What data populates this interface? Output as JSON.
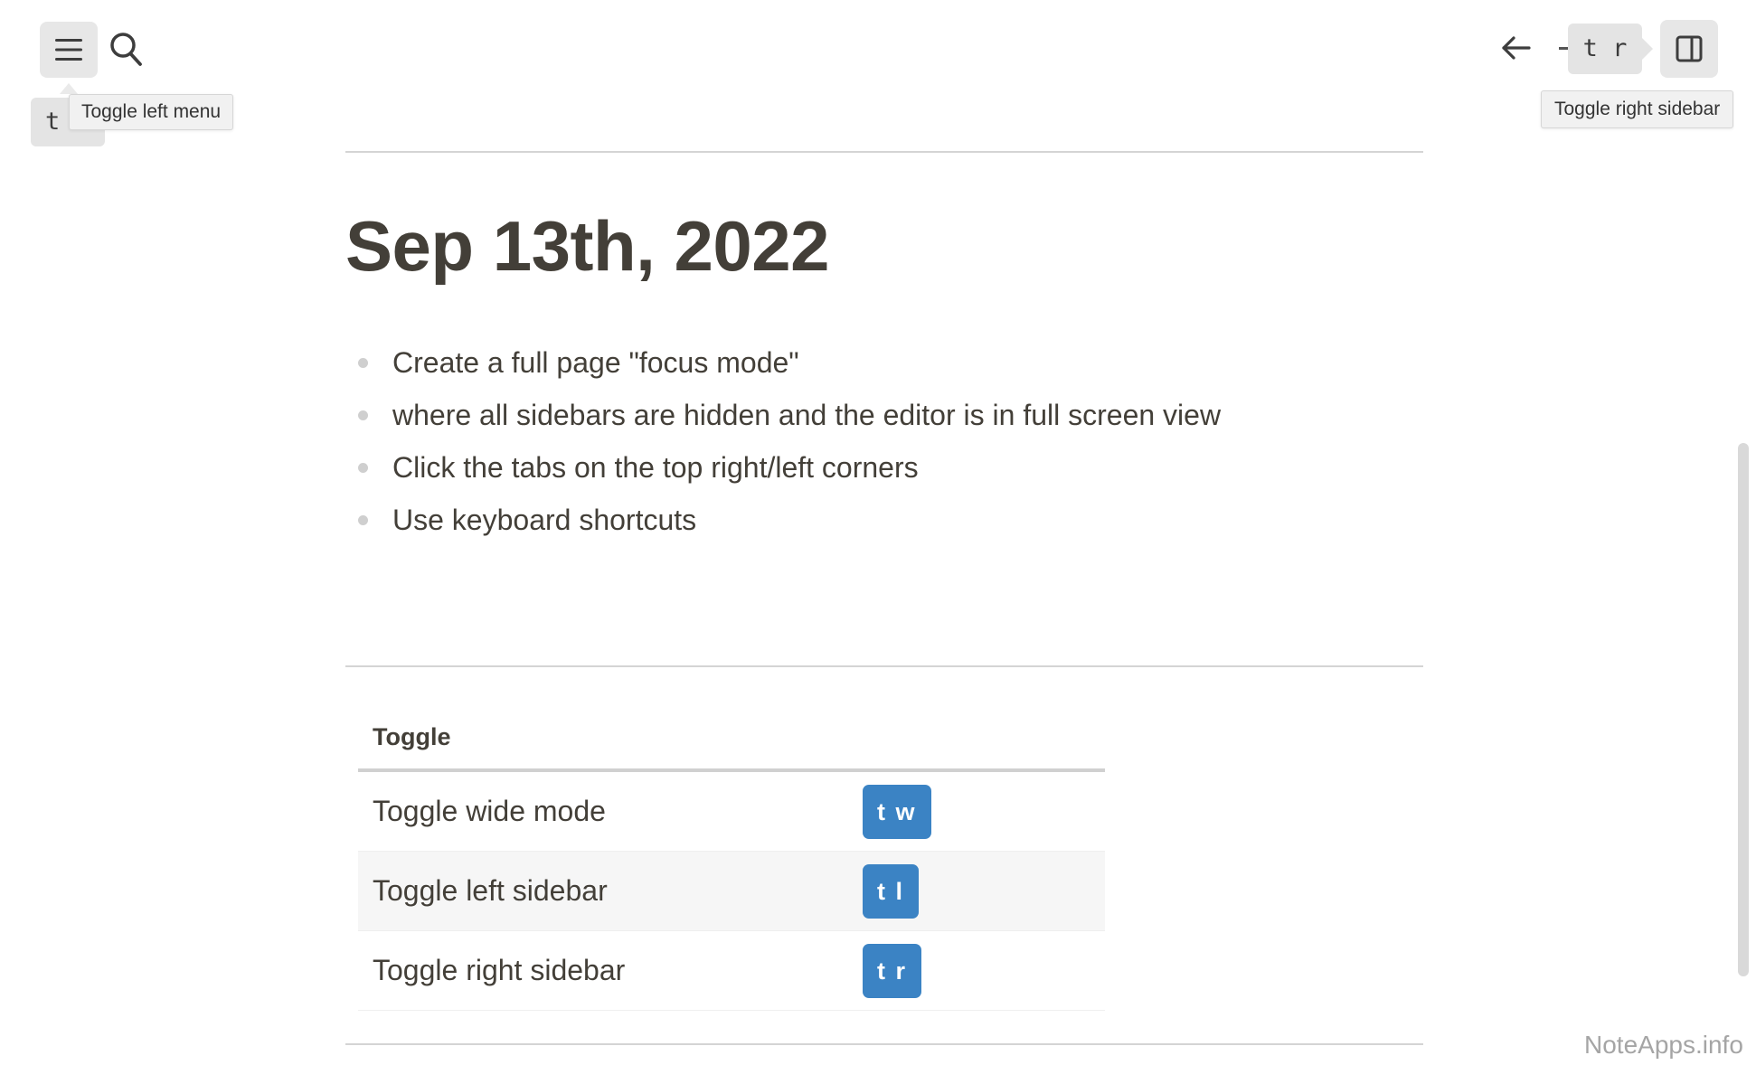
{
  "header": {
    "left_menu_tooltip": "Toggle left menu",
    "left_menu_shortcut": "t l",
    "right_sidebar_tooltip": "Toggle right sidebar",
    "right_sidebar_shortcut": "t r"
  },
  "page": {
    "title": "Sep 13th, 2022",
    "bullets": [
      "Create a full page \"focus mode\"",
      "where all sidebars are hidden and the editor is in full screen view",
      "Click the tabs on the top right/left corners",
      "Use keyboard shortcuts"
    ]
  },
  "table": {
    "header": "Toggle",
    "rows": [
      {
        "label": "Toggle wide mode",
        "keys": "t w"
      },
      {
        "label": "Toggle left sidebar",
        "keys": "t l"
      },
      {
        "label": "Toggle right sidebar",
        "keys": "t r"
      }
    ]
  },
  "watermark": "NoteApps.info",
  "colors": {
    "accent": "#3b83c4",
    "text": "#433f38",
    "button_bg": "#e7e7e7"
  },
  "icons": [
    "hamburger-icon",
    "search-icon",
    "arrow-left-icon",
    "sidebar-right-icon"
  ]
}
